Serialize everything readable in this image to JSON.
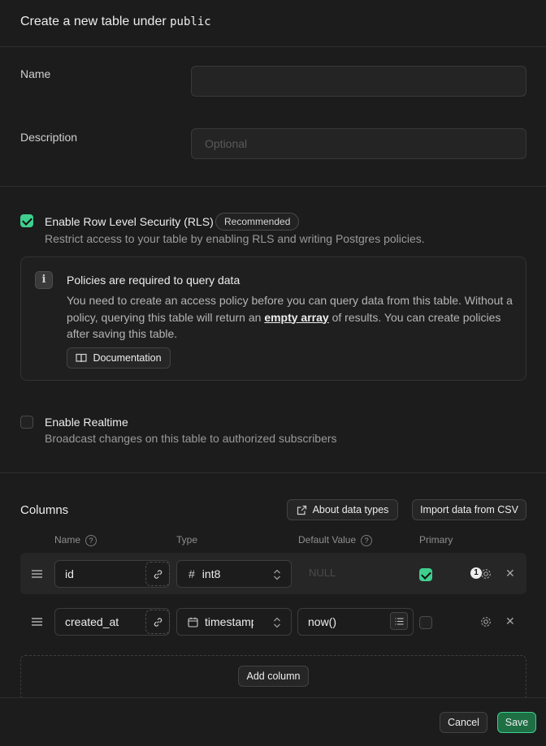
{
  "header": {
    "title_prefix": "Create a new table under",
    "schema": "public"
  },
  "form": {
    "name_label": "Name",
    "name_value": "",
    "description_label": "Description",
    "description_placeholder": "Optional"
  },
  "rls": {
    "checked": true,
    "title": "Enable Row Level Security (RLS)",
    "badge": "Recommended",
    "description": "Restrict access to your table by enabling RLS and writing Postgres policies."
  },
  "callout": {
    "title": "Policies are required to query data",
    "body_before": "You need to create an access policy before you can query data from this table. Without a policy, querying this table will return an",
    "body_link": "empty array",
    "body_after": "of results. You can create policies after saving this table.",
    "doc_button": "Documentation"
  },
  "realtime": {
    "checked": false,
    "title": "Enable Realtime",
    "description": "Broadcast changes on this table to authorized subscribers"
  },
  "columns": {
    "title": "Columns",
    "about_button": "About data types",
    "import_button": "Import data from CSV",
    "headers": {
      "name": "Name",
      "type": "Type",
      "default": "Default Value",
      "primary": "Primary"
    },
    "rows": [
      {
        "name": "id",
        "type": "int8",
        "type_icon": "hash-icon",
        "default": "",
        "default_placeholder": "NULL",
        "primary": true,
        "badge": "1"
      },
      {
        "name": "created_at",
        "type": "timestamp",
        "type_icon": "calendar-icon",
        "default": "now()",
        "primary": false
      }
    ],
    "add_button": "Add column"
  },
  "footer": {
    "cancel": "Cancel",
    "save": "Save"
  },
  "colors": {
    "accent": "#3ecf8e",
    "background": "#1c1c1c"
  }
}
